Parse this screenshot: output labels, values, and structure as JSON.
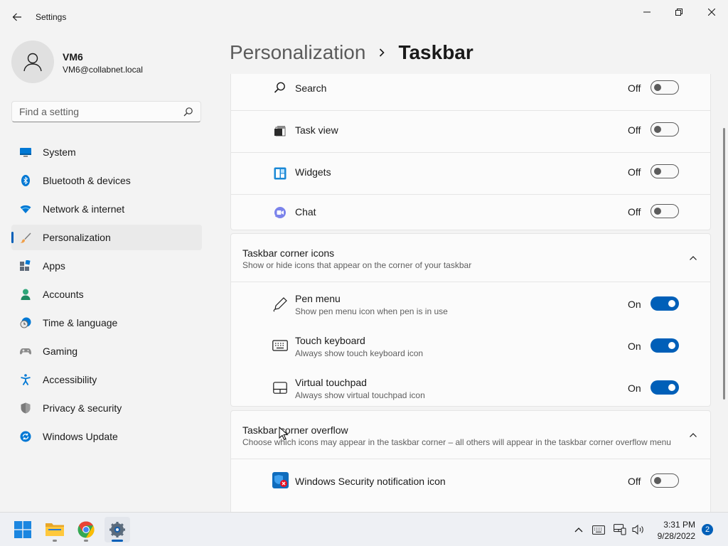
{
  "window": {
    "title": "Settings"
  },
  "profile": {
    "name": "VM6",
    "email": "VM6@collabnet.local"
  },
  "search": {
    "placeholder": "Find a setting"
  },
  "nav": {
    "items": [
      {
        "label": "System",
        "icon": "monitor-icon"
      },
      {
        "label": "Bluetooth & devices",
        "icon": "bluetooth-icon"
      },
      {
        "label": "Network & internet",
        "icon": "wifi-icon"
      },
      {
        "label": "Personalization",
        "icon": "brush-icon",
        "selected": true
      },
      {
        "label": "Apps",
        "icon": "apps-icon"
      },
      {
        "label": "Accounts",
        "icon": "person-icon"
      },
      {
        "label": "Time & language",
        "icon": "clock-globe-icon"
      },
      {
        "label": "Gaming",
        "icon": "gamepad-icon"
      },
      {
        "label": "Accessibility",
        "icon": "accessibility-icon"
      },
      {
        "label": "Privacy & security",
        "icon": "shield-icon"
      },
      {
        "label": "Windows Update",
        "icon": "update-icon"
      }
    ]
  },
  "header": {
    "parent": "Personalization",
    "current": "Taskbar"
  },
  "taskbar_items": {
    "rows": [
      {
        "label": "Search",
        "state": "Off",
        "on": false,
        "icon": "search-icon"
      },
      {
        "label": "Task view",
        "state": "Off",
        "on": false,
        "icon": "task-view-icon"
      },
      {
        "label": "Widgets",
        "state": "Off",
        "on": false,
        "icon": "widgets-icon"
      },
      {
        "label": "Chat",
        "state": "Off",
        "on": false,
        "icon": "chat-icon"
      }
    ]
  },
  "corner_icons": {
    "title": "Taskbar corner icons",
    "subtitle": "Show or hide icons that appear on the corner of your taskbar",
    "expanded": true,
    "rows": [
      {
        "label": "Pen menu",
        "sub": "Show pen menu icon when pen is in use",
        "state": "On",
        "on": true,
        "icon": "pen-icon"
      },
      {
        "label": "Touch keyboard",
        "sub": "Always show touch keyboard icon",
        "state": "On",
        "on": true,
        "icon": "keyboard-icon"
      },
      {
        "label": "Virtual touchpad",
        "sub": "Always show virtual touchpad icon",
        "state": "On",
        "on": true,
        "icon": "touchpad-icon"
      }
    ]
  },
  "corner_overflow": {
    "title": "Taskbar corner overflow",
    "subtitle": "Choose which icons may appear in the taskbar corner – all others will appear in the taskbar corner overflow menu",
    "expanded": true,
    "rows": [
      {
        "label": "Windows Security notification icon",
        "state": "Off",
        "on": false,
        "icon": "windows-security-icon"
      }
    ]
  },
  "system_taskbar": {
    "apps": [
      "windows-start-icon",
      "file-explorer-icon",
      "chrome-icon",
      "settings-icon"
    ],
    "time": "3:31 PM",
    "date": "9/28/2022",
    "notification_count": "2"
  },
  "colors": {
    "accent": "#005fb8",
    "background": "#f3f3f3",
    "card": "#fbfbfb"
  }
}
